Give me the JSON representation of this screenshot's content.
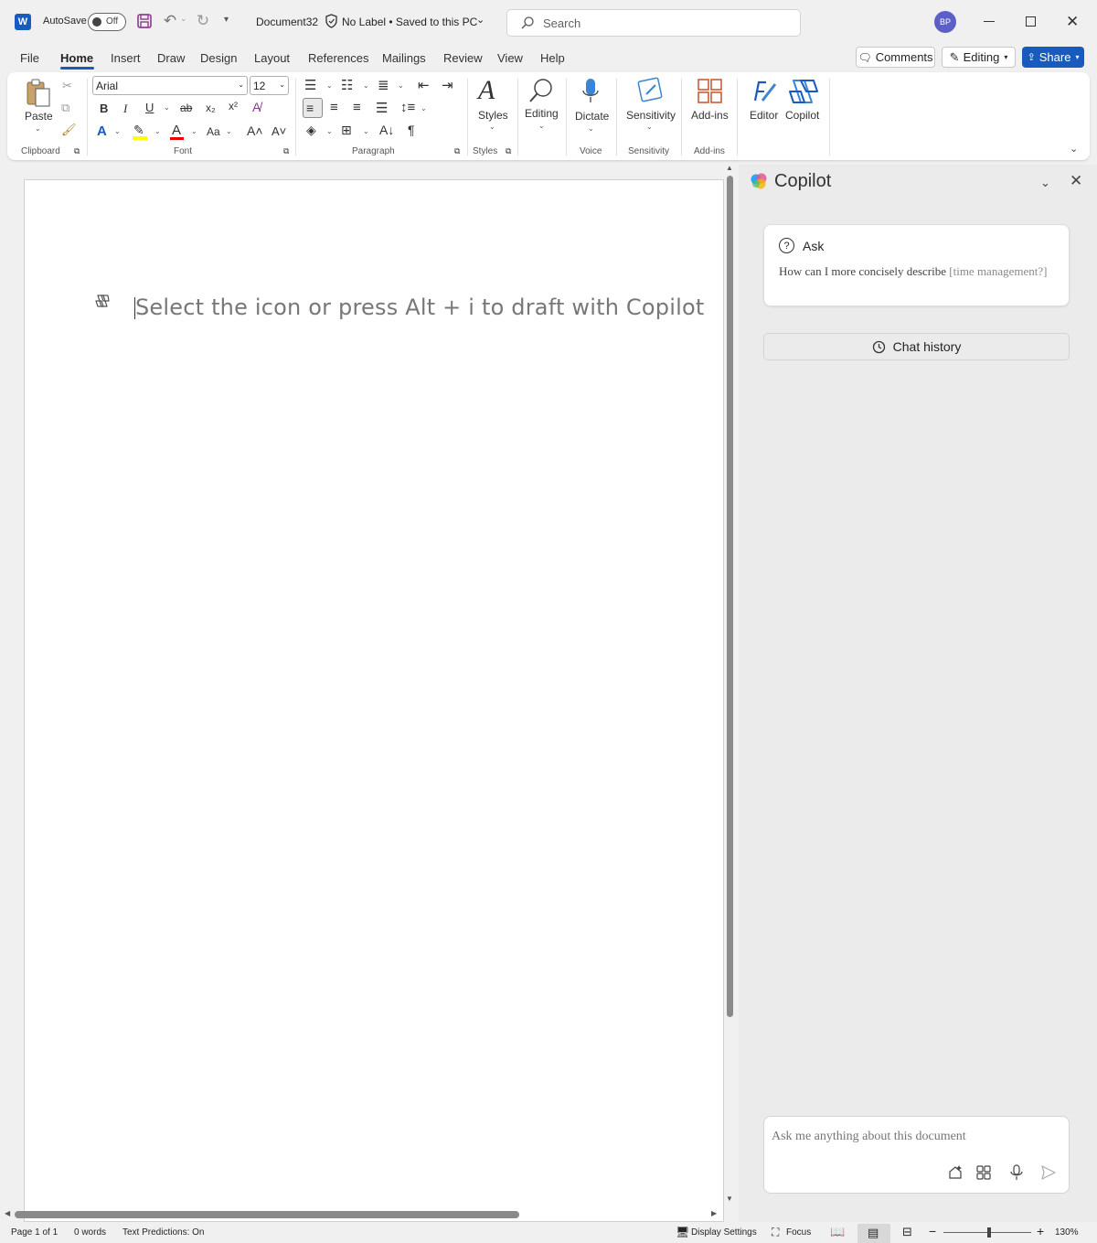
{
  "titlebar": {
    "app_logo": "W",
    "autosave_label": "AutoSave",
    "autosave_state": "Off",
    "doc_name": "Document32",
    "label_status": "No Label • Saved to this PC",
    "search_placeholder": "Search",
    "avatar_initials": "BP"
  },
  "tabs": [
    "File",
    "Home",
    "Insert",
    "Draw",
    "Design",
    "Layout",
    "References",
    "Mailings",
    "Review",
    "View",
    "Help"
  ],
  "active_tab": "Home",
  "actions": {
    "comments": "Comments",
    "editing": "Editing",
    "share": "Share"
  },
  "ribbon": {
    "paste_label": "Paste",
    "font_name": "Arial",
    "font_size": "12",
    "styles_label": "Styles",
    "editing_label": "Editing",
    "dictate_label": "Dictate",
    "sensitivity_label": "Sensitivity",
    "addins_label": "Add-ins",
    "editor_label": "Editor",
    "copilot_label": "Copilot",
    "groups": {
      "clipboard": "Clipboard",
      "font": "Font",
      "paragraph": "Paragraph",
      "styles": "Styles",
      "voice": "Voice",
      "sensitivity": "Sensitivity",
      "addins": "Add-ins"
    }
  },
  "document": {
    "draft_hint": "Select the icon or press Alt + i to draft with Copilot"
  },
  "copilot": {
    "title": "Copilot",
    "ask_title": "Ask",
    "ask_prompt": "How can I more concisely describe ",
    "ask_prompt_placeholder": "[time management?]",
    "chat_history": "Chat history",
    "input_placeholder": "Ask me anything about this document"
  },
  "statusbar": {
    "page": "Page 1 of 1",
    "words": "0 words",
    "predictions": "Text Predictions: On",
    "display_settings": "Display Settings",
    "focus": "Focus",
    "zoom": "130%",
    "zoom_level_fraction": 0.52
  },
  "colors": {
    "brand": "#185abd",
    "avatar": "#5b5fc7"
  }
}
